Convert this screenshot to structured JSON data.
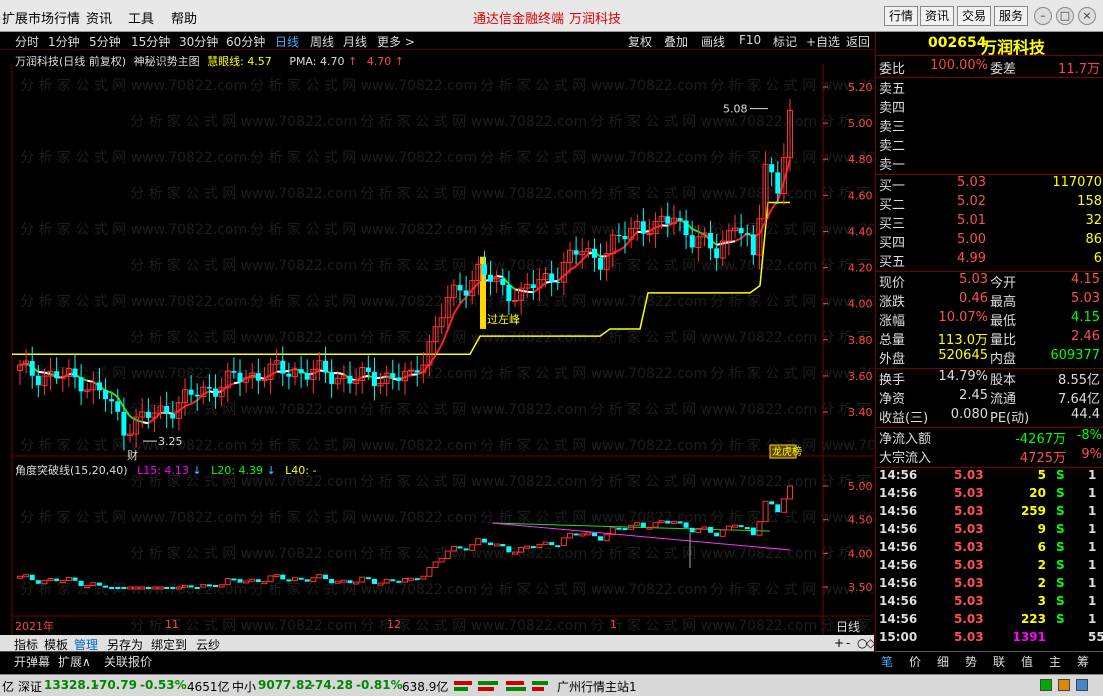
{
  "titlebar": {
    "menus": [
      "扩展市场行情",
      "资讯",
      "工具",
      "帮助"
    ],
    "ads": [
      "通达信金融终端",
      "万润科技"
    ],
    "buttons": [
      "行情",
      "资讯",
      "交易",
      "服务"
    ]
  },
  "periods": [
    "分时",
    "1分钟",
    "5分钟",
    "15分钟",
    "30分钟",
    "60分钟",
    "日线",
    "周线",
    "月线",
    "更多 >"
  ],
  "active_period": "日线",
  "actions": [
    "复权",
    "叠加",
    "画线",
    "F10",
    "标记",
    "+自选",
    "返回"
  ],
  "info_main": {
    "stock": "万润科技(日线 前复权)",
    "indicator": "神秘识势主图",
    "line1_label": "慧眼线:",
    "line1_value": "4.57",
    "pma_label": "PMA:",
    "pma_value": "4.70",
    "pma2_value": "4.70"
  },
  "info_sub": {
    "name": "角度突破线(15,20,40)",
    "l15": "L15: 4.13",
    "l20": "L20: 4.39",
    "l40": "L40: -"
  },
  "price_axis": [
    "5.20",
    "5.00",
    "4.80",
    "4.60",
    "4.40",
    "4.20",
    "4.00",
    "3.80",
    "3.60",
    "3.40"
  ],
  "sub_axis": [
    "5.00",
    "4.50",
    "4.00",
    "3.50"
  ],
  "annotations": {
    "high": "5.08",
    "low": "3.25",
    "left_peak": "过左峰",
    "cai": "财",
    "longhu": "龙虎榜"
  },
  "time_axis": [
    "2021年",
    "11",
    "12",
    "1"
  ],
  "period_label": "日线",
  "zoom": [
    "+",
    "-",
    "○",
    "◇"
  ],
  "watermark": "分 析 家 公 式 网 www.70822.com",
  "rpanel": {
    "code": "002654",
    "name": "万润科技",
    "weibi_label": "委比",
    "weibi": "100.00%",
    "weicha_label": "委差",
    "weicha": "11.7万",
    "sells": [
      "卖五",
      "卖四",
      "卖三",
      "卖二",
      "卖一"
    ],
    "buys": [
      {
        "label": "买一",
        "price": "5.03",
        "vol": "117070"
      },
      {
        "label": "买二",
        "price": "5.02",
        "vol": "158"
      },
      {
        "label": "买三",
        "price": "5.01",
        "vol": "32"
      },
      {
        "label": "买四",
        "price": "5.00",
        "vol": "86"
      },
      {
        "label": "买五",
        "price": "4.99",
        "vol": "6"
      }
    ],
    "stats": [
      {
        "l": "现价",
        "v": "5.03",
        "l2": "今开",
        "v2": "4.15"
      },
      {
        "l": "涨跌",
        "v": "0.46",
        "l2": "最高",
        "v2": "5.03"
      },
      {
        "l": "涨幅",
        "v": "10.07%",
        "l2": "最低",
        "v2": "4.15"
      },
      {
        "l": "总量",
        "v": "113.0万",
        "l2": "量比",
        "v2": "2.46"
      },
      {
        "l": "外盘",
        "v": "520645",
        "l2": "内盘",
        "v2": "609377"
      }
    ],
    "stats2": [
      {
        "l": "换手",
        "v": "14.79%",
        "l2": "股本",
        "v2": "8.55亿"
      },
      {
        "l": "净资",
        "v": "2.45",
        "l2": "流通",
        "v2": "7.64亿"
      },
      {
        "l": "收益(三)",
        "v": "0.080",
        "l2": "PE(动)",
        "v2": "44.4"
      }
    ],
    "flow": [
      {
        "l": "净流入额",
        "v": "-4267万",
        "p": "-8%"
      },
      {
        "l": "大宗流入",
        "v": "4725万",
        "p": "9%"
      }
    ],
    "ticks": [
      {
        "t": "14:56",
        "p": "5.03",
        "v": "5",
        "s": "S",
        "n": "1"
      },
      {
        "t": "14:56",
        "p": "5.03",
        "v": "20",
        "s": "S",
        "n": "1"
      },
      {
        "t": "14:56",
        "p": "5.03",
        "v": "259",
        "s": "S",
        "n": "1"
      },
      {
        "t": "14:56",
        "p": "5.03",
        "v": "9",
        "s": "S",
        "n": "1"
      },
      {
        "t": "14:56",
        "p": "5.03",
        "v": "6",
        "s": "S",
        "n": "1"
      },
      {
        "t": "14:56",
        "p": "5.03",
        "v": "2",
        "s": "S",
        "n": "1"
      },
      {
        "t": "14:56",
        "p": "5.03",
        "v": "2",
        "s": "S",
        "n": "1"
      },
      {
        "t": "14:56",
        "p": "5.03",
        "v": "3",
        "s": "S",
        "n": "1"
      },
      {
        "t": "14:56",
        "p": "5.03",
        "v": "223",
        "s": "S",
        "n": "1"
      },
      {
        "t": "15:00",
        "p": "5.03",
        "v": "1391",
        "s": "",
        "n": "55"
      }
    ],
    "tabs": [
      "笔",
      "价",
      "细",
      "势",
      "联",
      "值",
      "主",
      "筹"
    ]
  },
  "tabs1": [
    "指标",
    "模板",
    "管理",
    "另存为",
    "绑定到",
    "云纱"
  ],
  "tabs2": [
    "开弹幕",
    "扩展∧",
    "关联报价"
  ],
  "status": {
    "prefix": "亿",
    "sz_label": "深证",
    "sz": "13328.1",
    "sz_chg": "-70.79",
    "sz_pct": "-0.53%",
    "sz_amt": "4651亿",
    "zx_label": "中小",
    "zx": "9077.82",
    "zx_chg": "-74.28",
    "zx_pct": "-0.81%",
    "zx_amt": "638.9亿",
    "server": "广州行情主站1"
  }
}
